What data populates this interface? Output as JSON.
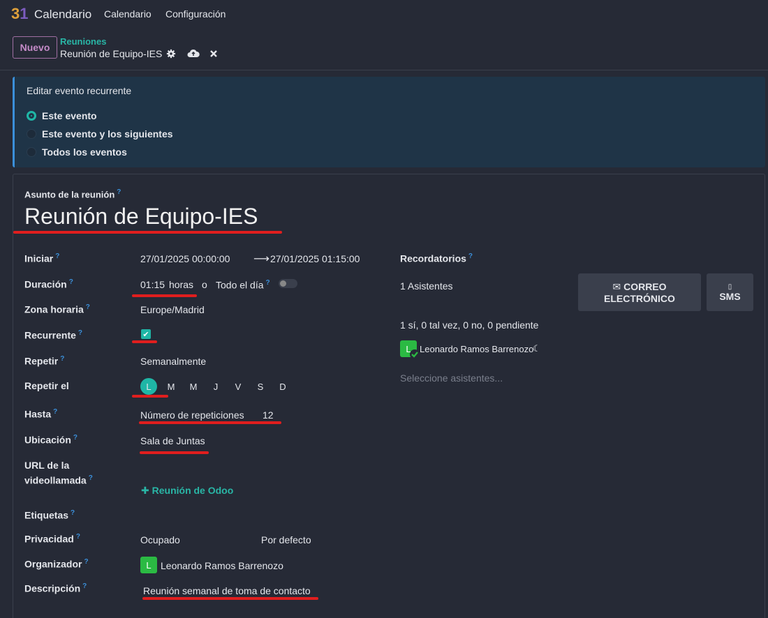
{
  "app": {
    "name": "Calendario",
    "logo": "31"
  },
  "menu": {
    "calendar": "Calendario",
    "config": "Configuración"
  },
  "breadcrumb": {
    "new_button": "Nuevo",
    "parent": "Reuniones",
    "current": "Reunión de Equipo-IES"
  },
  "recurrence_edit": {
    "title": "Editar evento recurrente",
    "options": [
      "Este evento",
      "Este evento y los siguientes",
      "Todos los eventos"
    ],
    "selected": 0
  },
  "form": {
    "subject_label": "Asunto de la reunión",
    "subject": "Reunión de Equipo-IES",
    "start_label": "Iniciar",
    "start": "27/01/2025 00:00:00",
    "end": "27/01/2025 01:15:00",
    "duration_label": "Duración",
    "duration": "01:15",
    "duration_unit": "horas",
    "or": "o",
    "allday_label": "Todo el día",
    "timezone_label": "Zona horaria",
    "timezone": "Europe/Madrid",
    "recurrent_label": "Recurrente",
    "repeat_label": "Repetir",
    "repeat": "Semanalmente",
    "repeat_on_label": "Repetir el",
    "days": [
      "L",
      "M",
      "M",
      "J",
      "V",
      "S",
      "D"
    ],
    "until_label": "Hasta",
    "until_type": "Número de repeticiones",
    "until_count": "12",
    "location_label": "Ubicación",
    "location": "Sala de Juntas",
    "videocall_label_1": "URL de la",
    "videocall_label_2": "videollamada",
    "videocall_link": "Reunión de Odoo",
    "tags_label": "Etiquetas",
    "privacy_label": "Privacidad",
    "privacy_show": "Ocupado",
    "privacy": "Por defecto",
    "organizer_label": "Organizador",
    "organizer": "Leonardo Ramos Barrenozo",
    "organizer_initial": "L",
    "description_label": "Descripción",
    "description": "Reunión semanal de toma de contacto"
  },
  "right": {
    "reminders_label": "Recordatorios",
    "attendees_count": "1 Asistentes",
    "email_button_1": "CORREO",
    "email_button_2": "ELECTRÓNICO",
    "sms_button": "SMS",
    "attendance_summary": "1 sí, 0 tal vez, 0 no, 0 pendiente",
    "attendee_name": "Leonardo Ramos Barrenozo",
    "attendee_initial": "L",
    "select_placeholder": "Seleccione asistentes..."
  },
  "colors": {
    "accent": "#1fb6a6",
    "brand": "#c58bc8",
    "highlight": "#e01e1e",
    "avatar": "#2bba43"
  }
}
